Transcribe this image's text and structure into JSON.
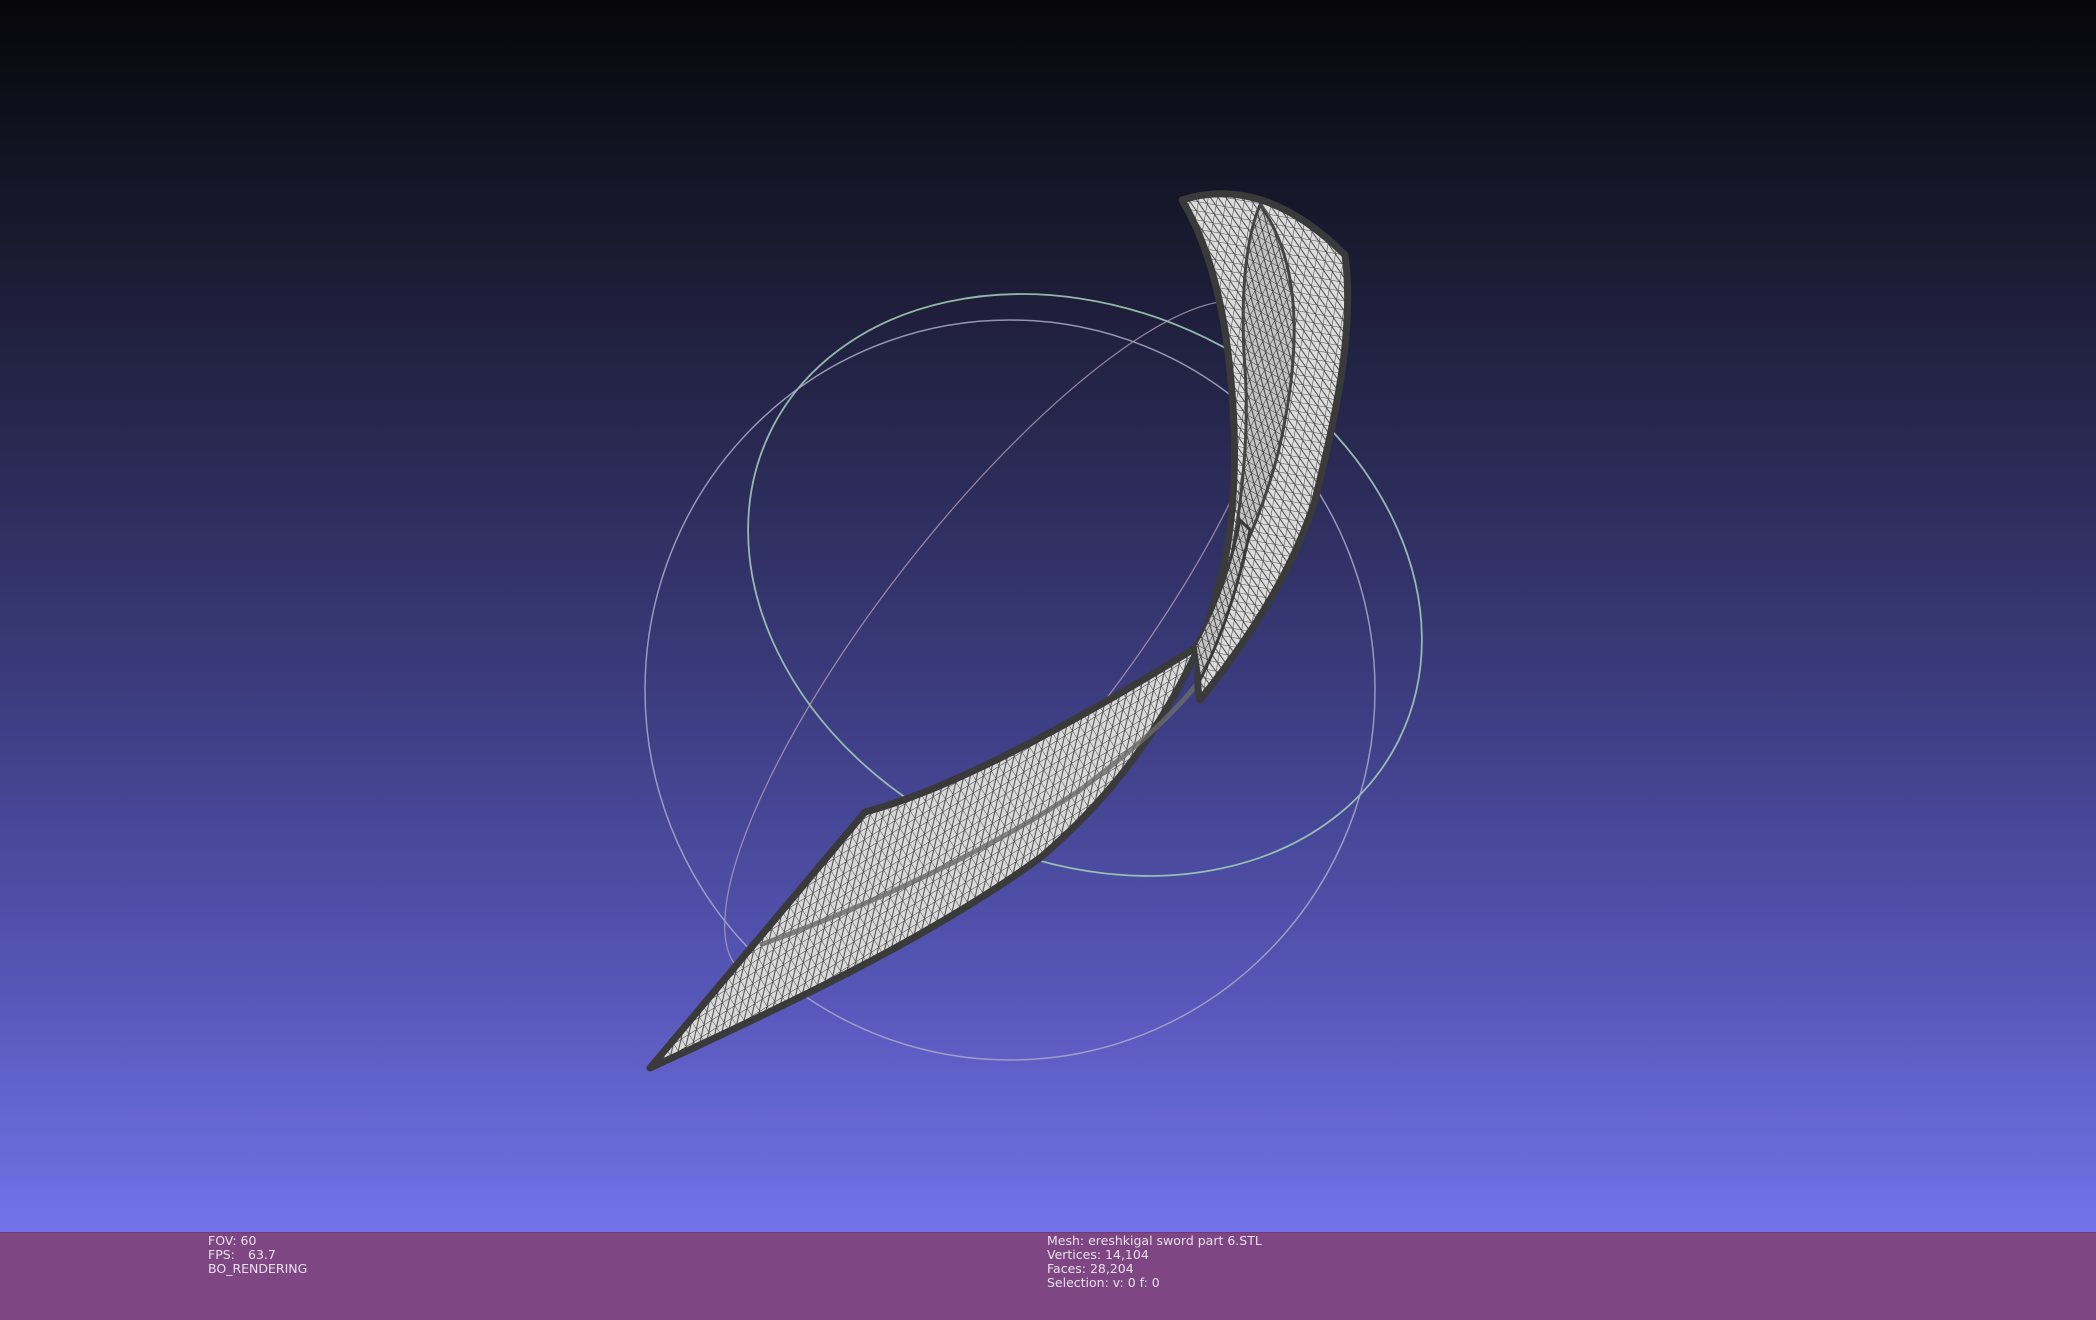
{
  "viewer": {
    "background_top": "#06060a",
    "background_bottom": "#7372e8",
    "statusbar_color": "#7e4683",
    "trackball_colors": [
      "#8fc9a9",
      "#b7a0b5",
      "#9aa5c7"
    ],
    "mesh_fill": "#d6d6d6",
    "mesh_edge": "#303030",
    "mesh_mode": "wireframe-on-solid"
  },
  "status": {
    "left": {
      "fov_label": "FOV: 60",
      "fps_label": "FPS:",
      "fps_value": "63.7",
      "render_mode": "BO_RENDERING"
    },
    "right": {
      "mesh_label": "Mesh: ereshkigal sword part 6.STL",
      "vertices_label": "Vertices: 14,104",
      "faces_label": "Faces: 28,204",
      "selection_label": "Selection: v: 0 f: 0"
    }
  }
}
